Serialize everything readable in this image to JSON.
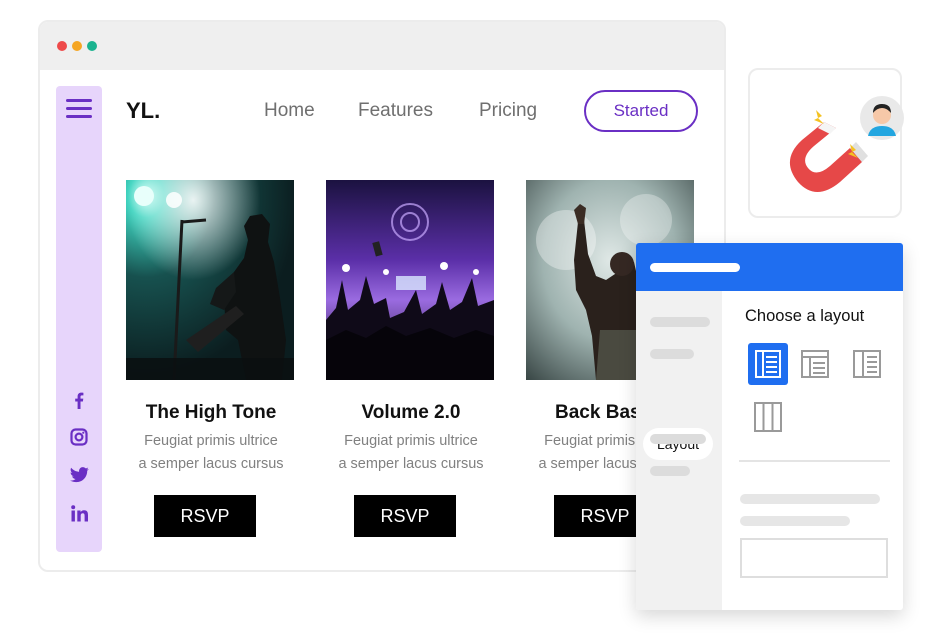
{
  "window": {
    "controls": [
      "close",
      "minimize",
      "maximize"
    ]
  },
  "site": {
    "logo": "YL.",
    "nav": [
      {
        "label": "Home"
      },
      {
        "label": "Features"
      },
      {
        "label": "Pricing"
      }
    ],
    "cta_label": "Started",
    "accent_color": "#6a2fc4"
  },
  "sidebar": {
    "menu_icon": "hamburger-icon",
    "social": [
      "facebook-icon",
      "instagram-icon",
      "twitter-icon",
      "linkedin-icon"
    ]
  },
  "cards": [
    {
      "title": "The High Tone",
      "desc_line1": "Feugiat primis ultrice",
      "desc_line2": "a semper lacus cursus",
      "button": "RSVP"
    },
    {
      "title": "Volume 2.0",
      "desc_line1": "Feugiat primis ultrice",
      "desc_line2": "a semper lacus cursus",
      "button": "RSVP"
    },
    {
      "title": "Back Basics",
      "desc_line1": "Feugiat primis ultrice",
      "desc_line2": "a semper lacus cursus",
      "button": "RSVP"
    }
  ],
  "magnet_card": {
    "icon": "magnet-icon",
    "avatar_icon": "user-avatar-icon"
  },
  "layout_panel": {
    "header_color": "#1f6ef0",
    "tab_label": "Layout",
    "title": "Choose a layout",
    "options": [
      "layout-sidebar-left-icon",
      "layout-header-icon",
      "layout-sidebar-right-icon",
      "layout-columns-icon"
    ],
    "selected_option": 0
  }
}
